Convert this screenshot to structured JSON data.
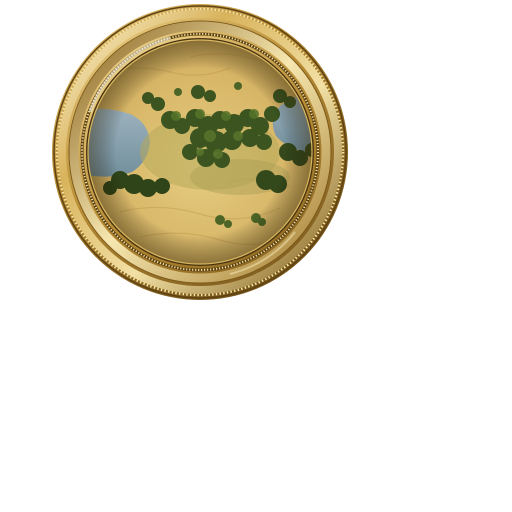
{
  "scene": {
    "type": "map-preview-medallion",
    "terrain": [
      "desert-sand",
      "water",
      "tree-cluster",
      "grassland"
    ],
    "frame": "ornate-gold-ring"
  },
  "colors": {
    "background": "#ffffff",
    "gold_light": "#f4e7b4",
    "gold_mid": "#c9a24a",
    "gold_dark": "#7a5a1c",
    "sand_light": "#e8cf86",
    "sand_mid": "#d6b466",
    "sand_dark": "#b89446",
    "water": "#8ea7b4",
    "water_dark": "#6f8b99",
    "tree_dark": "#2f4418",
    "tree_mid": "#4a6424",
    "tree_light": "#6e8a36",
    "grass": "#9fa65a"
  }
}
